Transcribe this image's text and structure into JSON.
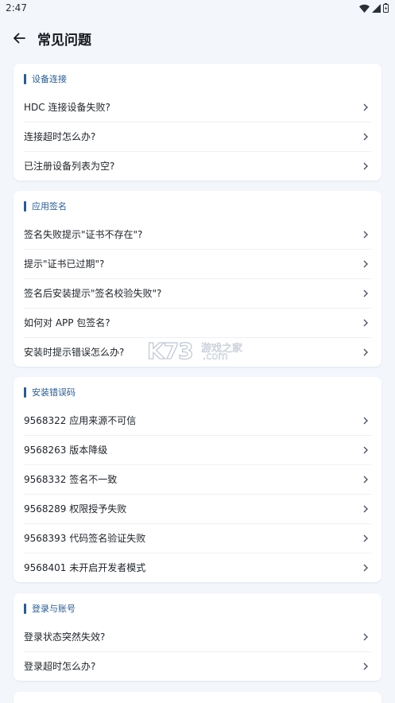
{
  "status": {
    "time": "2:47"
  },
  "header": {
    "title": "常见问题"
  },
  "watermark": {
    "k73": "K73",
    "cn": "游戏之家",
    "com": ".com"
  },
  "sections": [
    {
      "title": "设备连接",
      "items": [
        "HDC 连接设备失败?",
        "连接超时怎么办?",
        "已注册设备列表为空?"
      ]
    },
    {
      "title": "应用签名",
      "items": [
        "签名失败提示\"证书不存在\"?",
        "提示\"证书已过期\"?",
        "签名后安装提示\"签名校验失败\"?",
        "如何对 APP 包签名?",
        "安装时提示错误怎么办?"
      ]
    },
    {
      "title": "安装错误码",
      "items": [
        "9568322 应用来源不可信",
        "9568263 版本降级",
        "9568332 签名不一致",
        "9568289 权限授予失败",
        "9568393 代码签名验证失败",
        "9568401 未开启开发者模式"
      ]
    },
    {
      "title": "登录与账号",
      "items": [
        "登录状态突然失效?",
        "登录超时怎么办?"
      ]
    }
  ],
  "colors": {
    "accent": "#2c5c8e",
    "background": "#f3f6fb",
    "card": "#ffffff"
  }
}
